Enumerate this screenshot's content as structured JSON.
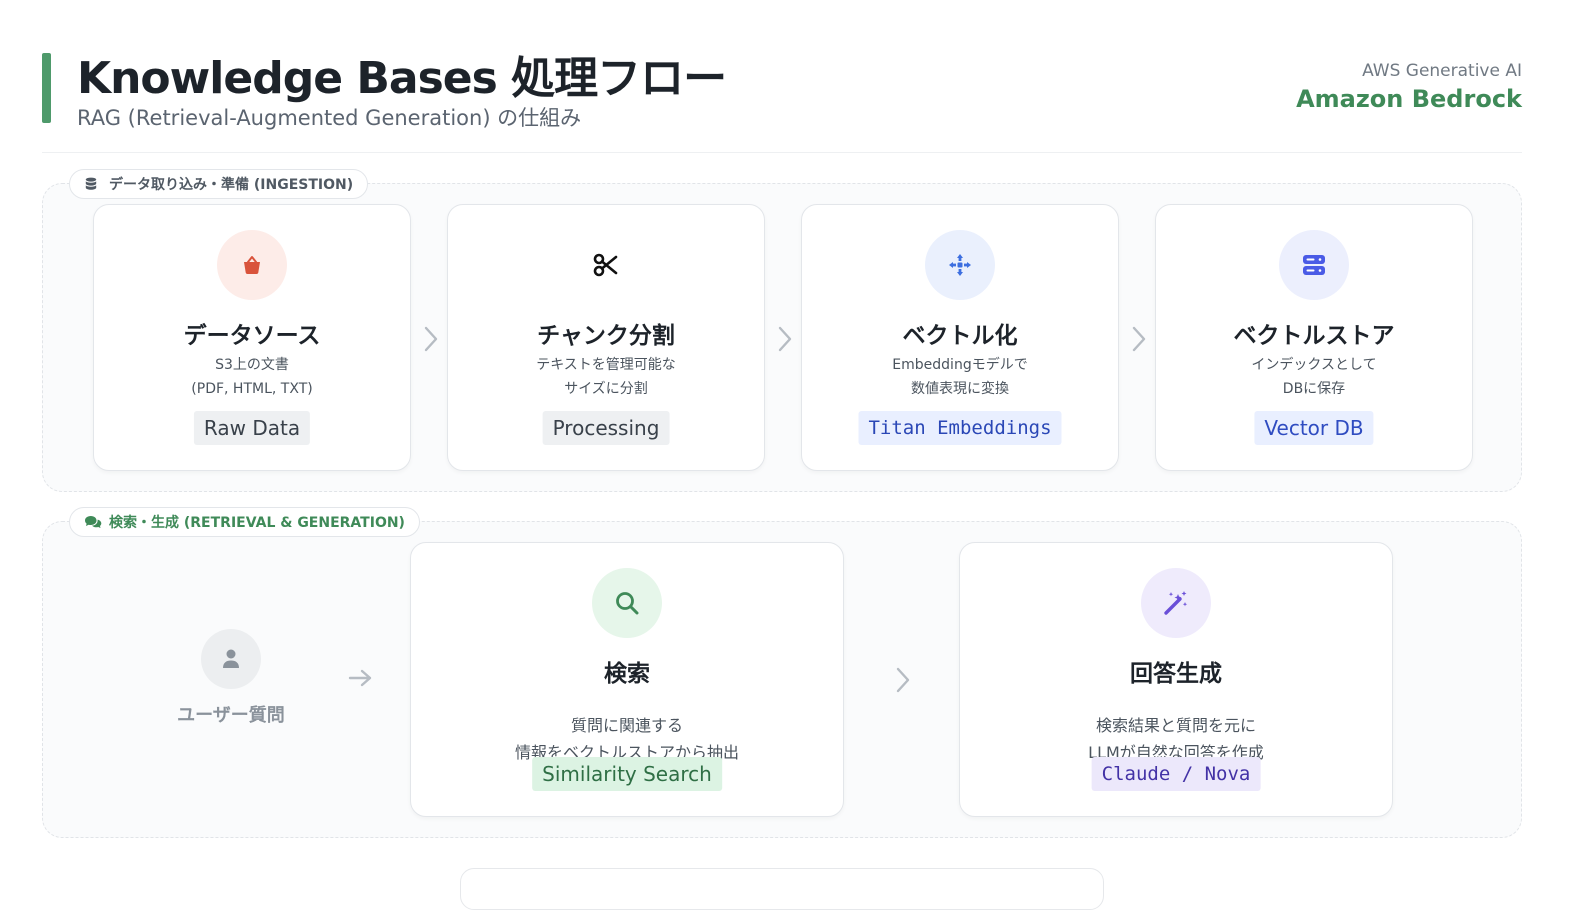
{
  "header": {
    "title": "Knowledge Bases 処理フロー",
    "subtitle": "RAG (Retrieval-Augmented Generation) の仕組み",
    "brand_top": "AWS Generative AI",
    "brand_main": "Amazon Bedrock"
  },
  "ingestion": {
    "label": "データ取り込み・準備 (INGESTION)",
    "icon": "database-icon",
    "steps": [
      {
        "title": "データソース",
        "desc1": "S3上の文書",
        "desc2": "(PDF, HTML, TXT)",
        "tag": "Raw Data",
        "icon": "bucket-icon",
        "icon_color": "#d9533b",
        "circle_color": "#fdece8"
      },
      {
        "title": "チャンク分割",
        "desc1": "テキストを管理可能な",
        "desc2": "サイズに分割",
        "tag": "Processing",
        "icon": "scissors-icon",
        "icon_color": "#111111",
        "circle_color": "#ffffff"
      },
      {
        "title": "ベクトル化",
        "desc1": "Embeddingモデルで",
        "desc2": "数値表現に変換",
        "tag": "Titan Embeddings",
        "icon": "arrows-converge-icon",
        "icon_color": "#3d6fe0",
        "circle_color": "#eaf0fd"
      },
      {
        "title": "ベクトルストア",
        "desc1": "インデックスとして",
        "desc2": "DBに保存",
        "tag": "Vector DB",
        "icon": "server-icon",
        "icon_color": "#4a5be6",
        "circle_color": "#eceffd"
      }
    ]
  },
  "retrieval": {
    "label": "検索・生成 (RETRIEVAL & GENERATION)",
    "icon": "comments-icon",
    "user_label": "ユーザー質問",
    "steps": [
      {
        "title": "検索",
        "desc1": "質問に関連する",
        "desc2": "情報をベクトルストアから抽出",
        "tag": "Similarity Search",
        "icon": "search-icon",
        "icon_color": "#3f8a58",
        "circle_color": "#e6f6ea"
      },
      {
        "title": "回答生成",
        "desc1": "検索結果と質問を元に",
        "desc2": "LLMが自然な回答を作成",
        "tag": "Claude / Nova",
        "icon": "magic-wand-icon",
        "icon_color": "#6a4fd8",
        "circle_color": "#efebfc"
      }
    ]
  },
  "colors": {
    "accent": "#4e9a6b",
    "brand": "#3f8a58"
  }
}
